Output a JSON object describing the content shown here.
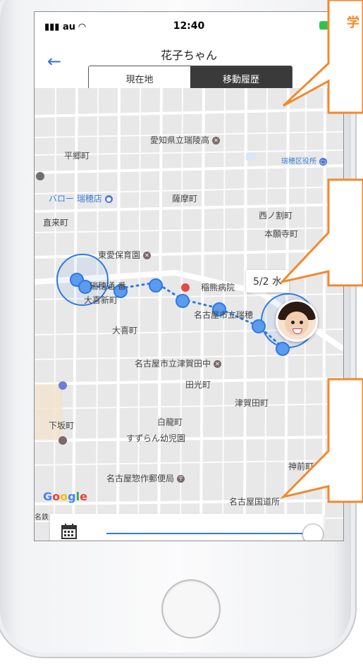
{
  "status_bar": {
    "carrier": "au",
    "time": "12:40"
  },
  "nav": {
    "title": "花子ちゃん",
    "back_icon": "arrow-left-icon"
  },
  "segments": {
    "current": "現在地",
    "history": "移動履歴"
  },
  "map": {
    "labels": {
      "school": "愛知県立瑞陵高",
      "heigo": "平郷町",
      "ward_office": "瑞穂区役所",
      "valor": "バロー 瑞穂店",
      "satsuma": "薩摩町",
      "nishinowari": "西ノ割町",
      "jikimai": "直来町",
      "honganji": "本願寺町",
      "higashi_hoikuen": "東愛保育園",
      "mizuho_ban": "瑞穂通",
      "ban_suffix": "番",
      "inakuma": "稲熊病院",
      "okishin": "大喜新町",
      "nagoya_mizuho": "名古屋市立瑞穂",
      "ookicho": "大喜町",
      "tsugata": "名古屋市立津賀田中",
      "denkou": "田光町",
      "tsugata_cho": "津賀田町",
      "shimosaka": "下坂町",
      "hakuryu": "白龍町",
      "suzuran": "すずらん幼児園",
      "kanmae": "神前町",
      "post": "名古屋惣作郵便局",
      "national": "名古屋国道",
      "national_suffix": "所",
      "railway": "名鉄"
    },
    "date_chip": "5/2 水",
    "google": {
      "g1": "G",
      "o1": "o",
      "o2": "o",
      "g2": "g",
      "l": "l",
      "e": "e"
    }
  },
  "callout": {
    "text": "学"
  },
  "colors": {
    "accent": "#2f7ae0",
    "callout": "#f08a2e"
  }
}
